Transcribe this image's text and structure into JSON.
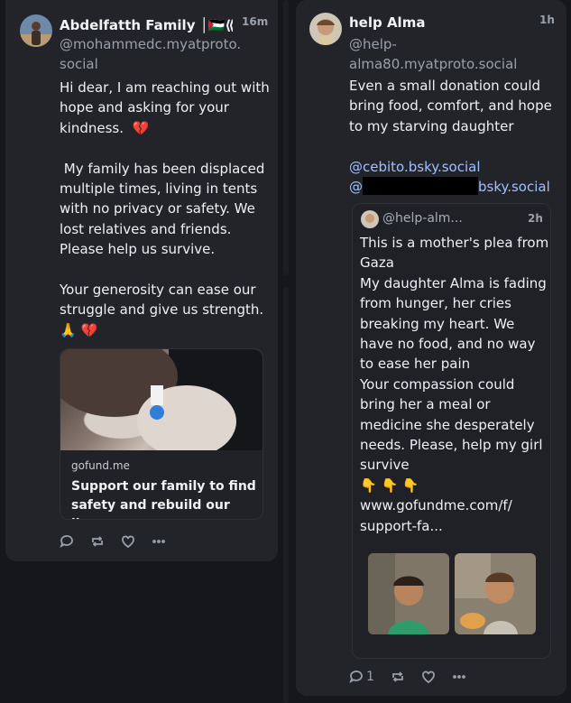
{
  "left_post": {
    "author_name": "Abdelfatth  Family │🇵🇸⟪ L...",
    "time": "16m",
    "handle": "@mohammedc.myatproto.\nsocial",
    "text": "Hi dear, I am reaching out with\nhope and asking for your\nkindness.  💔\n\n My family has been displaced\nmultiple times, living in tents\nwith no privacy or safety. We\nlost relatives and friends.\nPlease help us survive.\n\nYour generosity can ease our\nstruggle and give us strength.\n🙏 💔",
    "card": {
      "domain": "gofund.me",
      "title": "Support our family to find safety and rebuild our lives"
    },
    "actions": {
      "reply_icon": "reply-icon",
      "repost_icon": "repost-icon",
      "like_icon": "heart-icon",
      "more_icon": "more-icon"
    }
  },
  "right_post": {
    "author_name": "help Alma",
    "time": "1h",
    "handle": "@help-\nalma80.myatproto.social",
    "text": "Even a small donation could\nbring food, comfort, and hope\nto my starving daughter",
    "mention_1": "@cebito.bsky.social",
    "mention_2_prefix": "@",
    "mention_2_suffix": "bsky.social",
    "quote": {
      "author_name": "@help-alm...",
      "time": "2h",
      "text": "This is a mother's plea from\nGaza\nMy daughter Alma is fading\nfrom hunger, her cries\nbreaking my heart. We\nhave no food, and no way\nto ease her pain\nYour compassion could\nbring her a meal or\nmedicine she desperately\nneeds. Please, help my girl\nsurvive\n👇 👇 👇\nwww.gofundme.com/f/\nsupport-fa..."
    },
    "reply_count": "1",
    "actions": {
      "reply_icon": "reply-icon",
      "repost_icon": "repost-icon",
      "like_icon": "heart-icon",
      "more_icon": "more-icon"
    }
  }
}
